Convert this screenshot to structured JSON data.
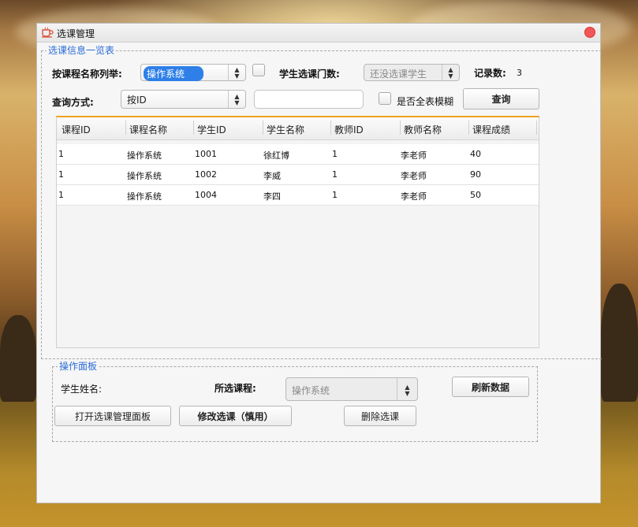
{
  "window": {
    "title": "选课管理"
  },
  "list_group": {
    "title": "选课信息一览表",
    "by_course_label": "按课程名称列举:",
    "by_course_value": "操作系统",
    "student_count_label": "学生选课门数:",
    "student_combo_value": "还没选课学生",
    "record_label": "记录数:",
    "record_count": "3",
    "query_mode_label": "查询方式:",
    "query_mode_value": "按ID",
    "query_input_value": "",
    "fuzzy_label": "是否全表模糊",
    "query_button": "查询"
  },
  "table": {
    "columns": [
      "课程ID",
      "课程名称",
      "学生ID",
      "学生名称",
      "教师ID",
      "教师名称",
      "课程成绩"
    ],
    "rows": [
      [
        "1",
        "操作系统",
        "1001",
        "徐红博",
        "1",
        "李老师",
        "40"
      ],
      [
        "1",
        "操作系统",
        "1002",
        "李威",
        "1",
        "李老师",
        "90"
      ],
      [
        "1",
        "操作系统",
        "1004",
        "李四",
        "1",
        "李老师",
        "50"
      ]
    ]
  },
  "ops_group": {
    "title": "操作面板",
    "student_name_label": "学生姓名:",
    "course_label": "所选课程:",
    "course_value": "操作系统",
    "refresh_button": "刷新数据",
    "open_panel_button": "打开选课管理面板",
    "modify_button": "修改选课（慎用）",
    "delete_button": "删除选课"
  },
  "colors": {
    "accent": "#2e7fe8",
    "close": "#f25757",
    "header_line": "#f0a020"
  }
}
